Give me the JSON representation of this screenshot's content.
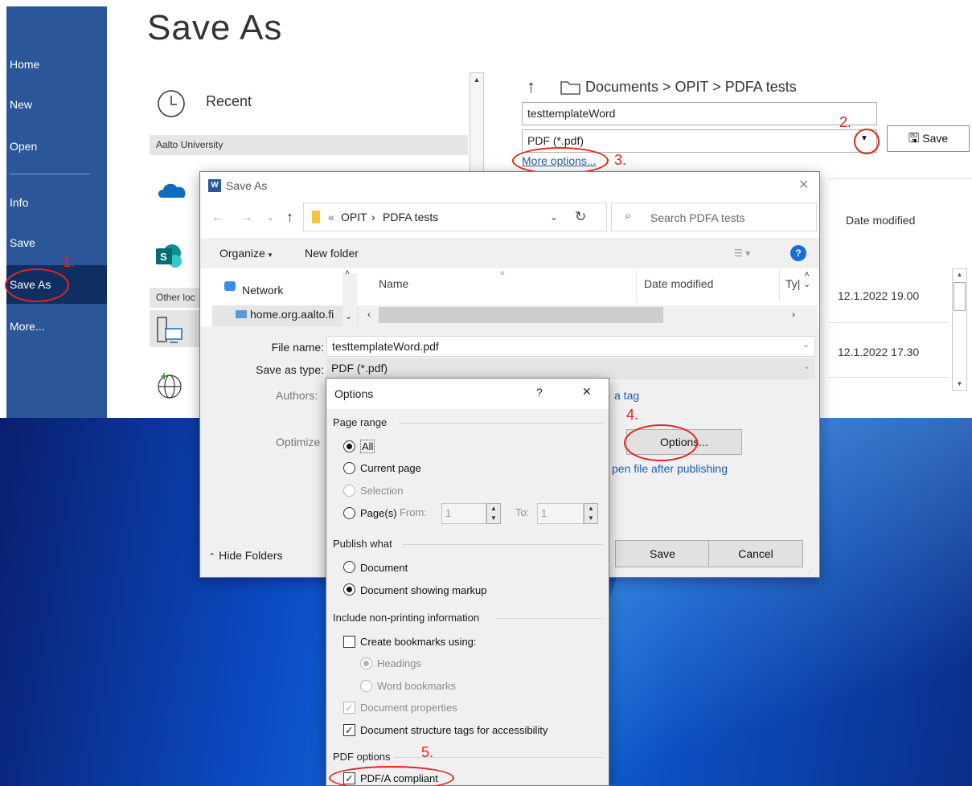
{
  "backstage": {
    "title": "Save As",
    "nav": [
      "Home",
      "New",
      "Open",
      "Info",
      "Save",
      "Save As",
      "More..."
    ],
    "recent_label": "Recent",
    "aalto_label": "Aalto University",
    "other_label": "Other loc",
    "breadcrumb": "Documents > OPIT > PDFA tests",
    "filename": "testtemplateWord",
    "filetype": "PDF (*.pdf)",
    "more_options": "More options...",
    "save_label": "Save",
    "date_modified_header": "Date modified",
    "dates": [
      "12.1.2022 19.00",
      "12.1.2022 17.30"
    ]
  },
  "annotations": [
    "1.",
    "2.",
    "3.",
    "4.",
    "5."
  ],
  "dialog": {
    "title": "Save As",
    "path_prefix": "«",
    "path_opit": "OPIT",
    "path_sep": "›",
    "path_pdfa": "PDFA tests",
    "search_placeholder": "Search PDFA tests",
    "organize": "Organize",
    "new_folder": "New folder",
    "tree_items": [
      "Network",
      "home.org.aalto.fi"
    ],
    "col_name": "Name",
    "col_date": "Date modified",
    "col_type": "Ty|",
    "file_name_label": "File name:",
    "file_name_value": "testtemplateWord.pdf",
    "save_type_label": "Save as type:",
    "save_type_value": "PDF (*.pdf)",
    "authors_label": "Authors:",
    "add_tag": "a tag",
    "optimize_label": "Optimize",
    "options_button": "Options...",
    "open_after": "pen file after publishing",
    "hide_folders": "Hide Folders",
    "save_button": "Save",
    "cancel_button": "Cancel"
  },
  "options": {
    "title": "Options",
    "help": "?",
    "close": "✕",
    "page_range": "Page range",
    "all": "All",
    "current_page": "Current page",
    "selection": "Selection",
    "pages": "Page(s)",
    "from_label": "From:",
    "from_value": "1",
    "to_label": "To:",
    "to_value": "1",
    "publish_what": "Publish what",
    "document": "Document",
    "document_markup": "Document showing markup",
    "include_nonprinting": "Include non-printing information",
    "create_bookmarks": "Create bookmarks using:",
    "headings": "Headings",
    "word_bookmarks": "Word bookmarks",
    "doc_properties": "Document properties",
    "doc_structure": "Document structure tags for accessibility",
    "pdf_options": "PDF options",
    "pdfa": "PDF/A compliant"
  }
}
